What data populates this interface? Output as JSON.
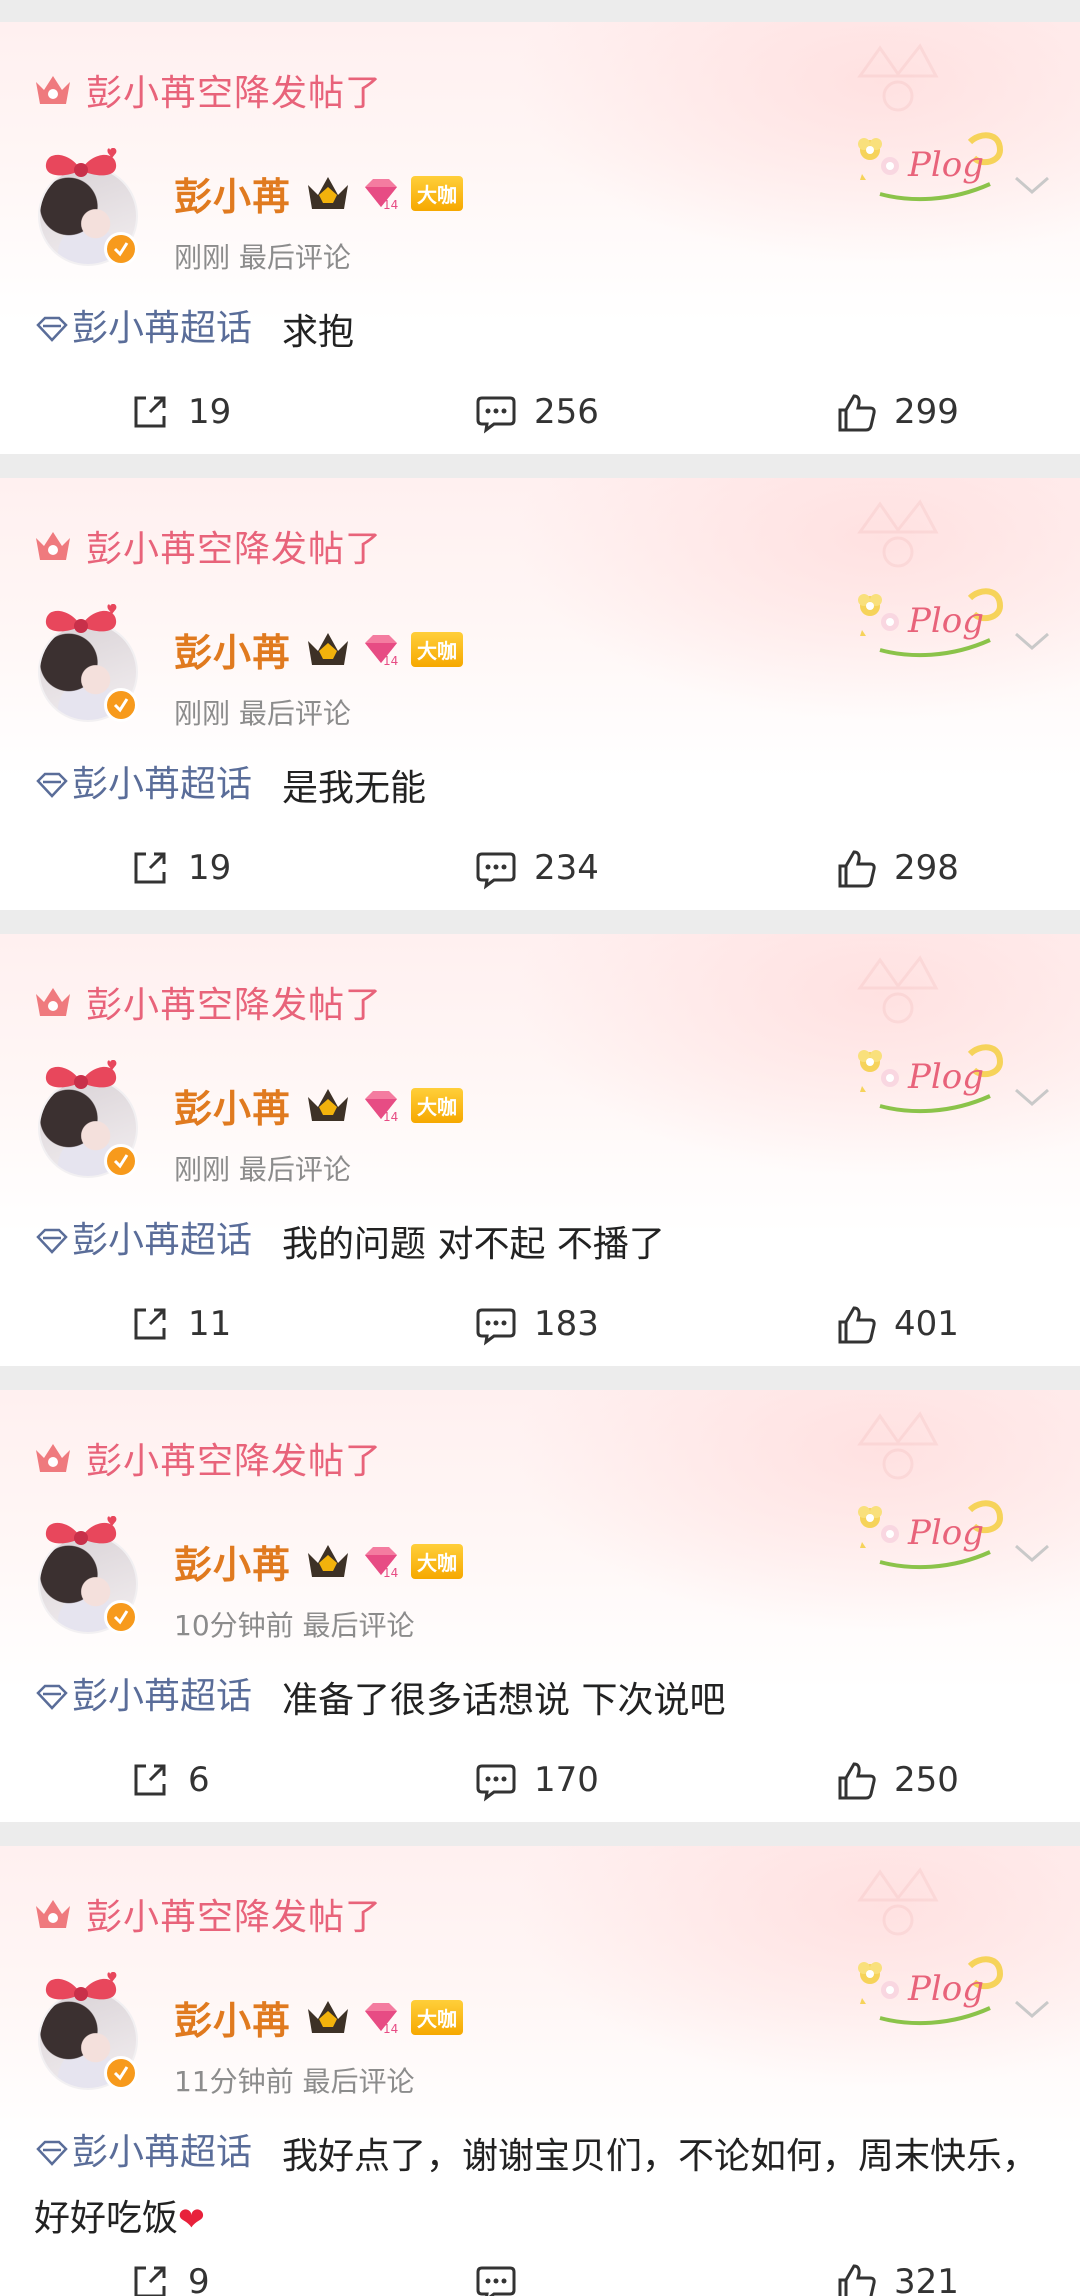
{
  "cards": [
    {
      "banner": "彭小苒空降发帖了",
      "username": "彭小苒",
      "badge": "大咖",
      "time": "刚刚",
      "meta_suffix": "最后评论",
      "topic": "彭小苒超话",
      "text": "求抱",
      "shares": "19",
      "comments": "256",
      "likes": "299"
    },
    {
      "banner": "彭小苒空降发帖了",
      "username": "彭小苒",
      "badge": "大咖",
      "time": "刚刚",
      "meta_suffix": "最后评论",
      "topic": "彭小苒超话",
      "text": "是我无能",
      "shares": "19",
      "comments": "234",
      "likes": "298"
    },
    {
      "banner": "彭小苒空降发帖了",
      "username": "彭小苒",
      "badge": "大咖",
      "time": "刚刚",
      "meta_suffix": "最后评论",
      "topic": "彭小苒超话",
      "text": "我的问题 对不起 不播了",
      "shares": "11",
      "comments": "183",
      "likes": "401"
    },
    {
      "banner": "彭小苒空降发帖了",
      "username": "彭小苒",
      "badge": "大咖",
      "time": "10分钟前",
      "meta_suffix": "最后评论",
      "topic": "彭小苒超话",
      "text": "准备了很多话想说 下次说吧",
      "shares": "6",
      "comments": "170",
      "likes": "250"
    },
    {
      "banner": "彭小苒空降发帖了",
      "username": "彭小苒",
      "badge": "大咖",
      "time": "11分钟前",
      "meta_suffix": "最后评论",
      "topic": "彭小苒超话",
      "text": "我好点了，谢谢宝贝们，不论如何，周末快乐，好好吃饭",
      "text_emoji": "❤",
      "shares": "9",
      "comments": "",
      "likes": "321"
    }
  ],
  "plog_label": "Plog",
  "colors": {
    "banner_text": "#e8637a",
    "username": "#e07a1f",
    "topic": "#5a6d99",
    "verified": "#f79a1c",
    "badge_gold": "#f6a800"
  },
  "icons": [
    "crown-icon",
    "verified-icon",
    "diamond-icon",
    "share-icon",
    "comment-icon",
    "like-icon",
    "chevron-down-icon"
  ]
}
